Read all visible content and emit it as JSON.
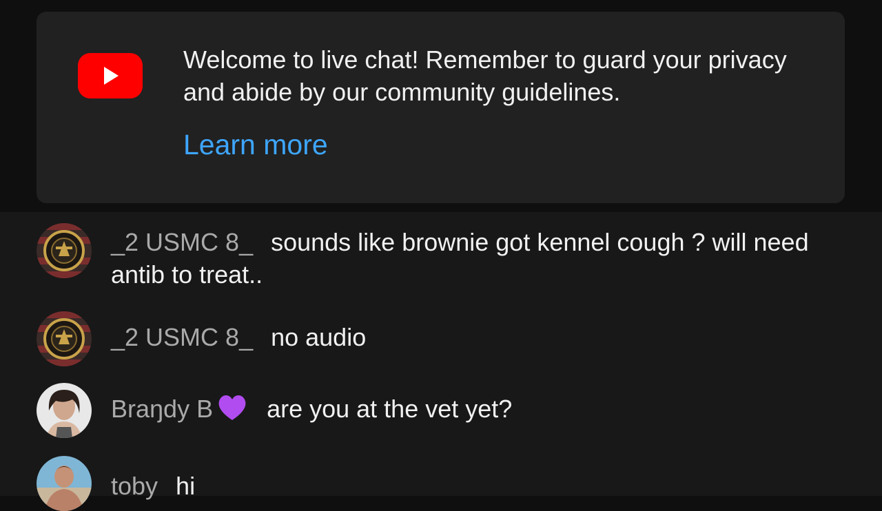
{
  "welcome": {
    "logo_icon": "youtube-play-icon",
    "message": "Welcome to live chat! Remember to guard your privacy and abide by our community guidelines.",
    "link_label": "Learn more"
  },
  "messages": [
    {
      "author": "_2 USMC 8_",
      "text": "sounds like brownie got kennel cough ? will need antib to treat..",
      "avatar": "usmc-emblem-avatar"
    },
    {
      "author": "_2 USMC 8_",
      "text": "no audio",
      "avatar": "usmc-emblem-avatar"
    },
    {
      "author": "Braŋdy B",
      "badge_icon": "purple-heart-icon",
      "text": "are you at the vet yet?",
      "avatar": "user-photo-avatar"
    },
    {
      "author": "toby",
      "text": "hi",
      "avatar": "user-photo-avatar"
    }
  ],
  "colors": {
    "page_bg": "#0f0f0f",
    "chat_bg": "#181818",
    "card_bg": "#212121",
    "link": "#3ea6ff",
    "brand_red": "#ff0000",
    "author_gray": "#aaaaaa",
    "heart_purple": "#b14cf0"
  }
}
